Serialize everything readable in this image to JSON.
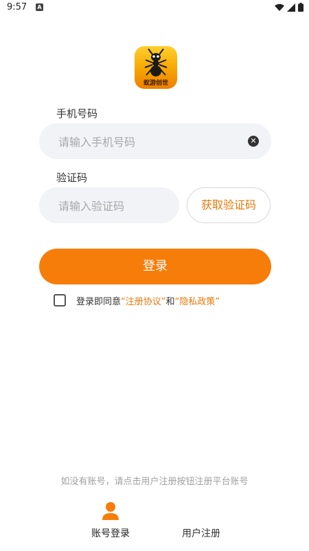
{
  "status_bar": {
    "time": "9:57",
    "notification_icon": "A"
  },
  "app": {
    "logo_text": "蚁游创世"
  },
  "phone": {
    "label": "手机号码",
    "placeholder": "请输入手机号码",
    "value": ""
  },
  "code": {
    "label": "验证码",
    "placeholder": "请输入验证码",
    "value": "",
    "get_code_label": "获取验证码"
  },
  "login": {
    "button_label": "登录"
  },
  "agreement": {
    "checked": false,
    "prefix": "登录即同意 ",
    "terms": "“注册协议”",
    "and": " 和 ",
    "privacy": "“隐私政策”"
  },
  "footer": {
    "hint": "如没有账号，请点击用户注册按钮注册平台账号"
  },
  "tabs": [
    {
      "label": "账号登录",
      "icon": "person-icon",
      "active": true
    },
    {
      "label": "用户注册",
      "icon": "register-icon",
      "active": false
    }
  ],
  "colors": {
    "accent": "#f77d0a",
    "link": "#e3790a",
    "input_bg": "#f2f3f7"
  }
}
